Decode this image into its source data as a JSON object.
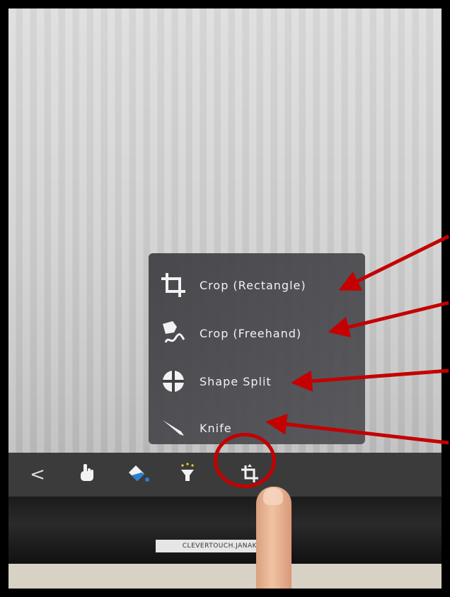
{
  "menu": {
    "items": [
      {
        "label": "Crop (Rectangle)",
        "icon": "crop-rectangle-icon"
      },
      {
        "label": "Crop (Freehand)",
        "icon": "crop-freehand-icon"
      },
      {
        "label": "Shape Split",
        "icon": "shape-split-icon"
      },
      {
        "label": "Knife",
        "icon": "knife-icon"
      }
    ]
  },
  "toolbar": {
    "back_label": "<",
    "buttons": [
      "hand-tool-icon",
      "fill-bucket-icon",
      "highlighter-icon",
      "crop-tool-icon"
    ]
  },
  "device": {
    "brand_text": "CLEVERTOUCH.JANAKI"
  },
  "colors": {
    "annotation_red": "#c40000",
    "menu_bg": "#414146",
    "toolbar_bg": "#3b3b3b"
  }
}
